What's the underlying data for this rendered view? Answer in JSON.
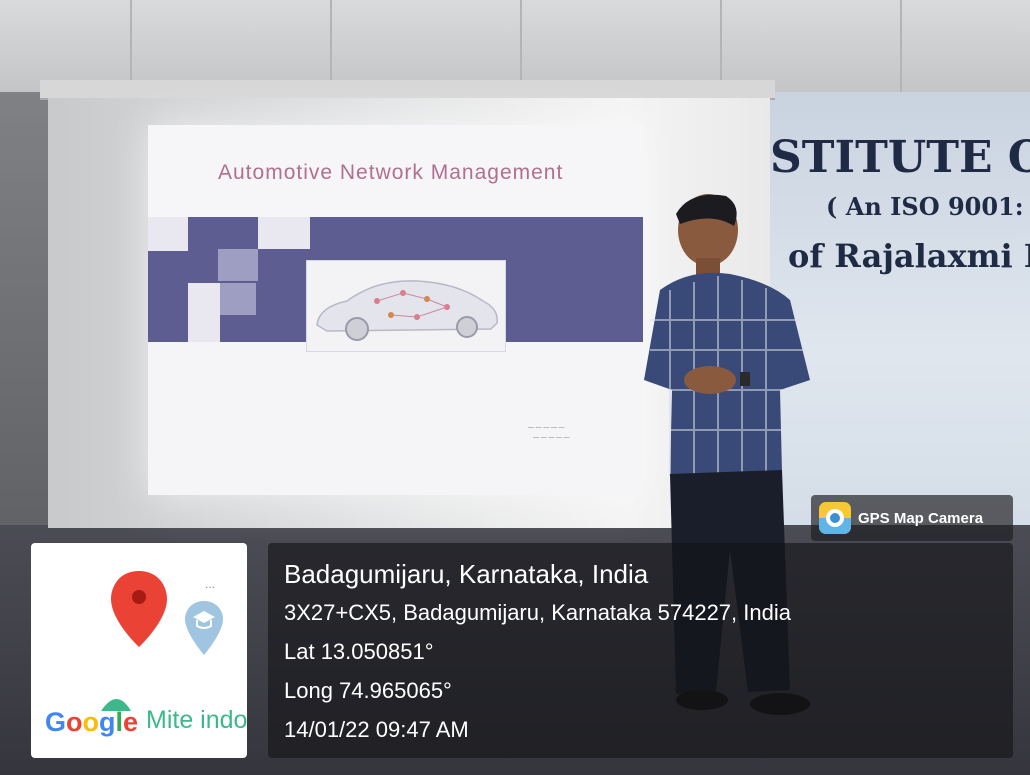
{
  "photo": {
    "slide": {
      "title": "Automotive Network Management"
    },
    "banner": {
      "line1": "STITUTE O",
      "line2": "( An ISO 9001:",
      "line3": "of Rajalaxmi E"
    }
  },
  "map": {
    "more_label": "...",
    "google_letters": [
      "G",
      "o",
      "o",
      "g",
      "l",
      "e"
    ],
    "google_colors": [
      "#4285f4",
      "#ea4335",
      "#fbbc05",
      "#4285f4",
      "#34a853",
      "#ea4335"
    ],
    "place_label": "Mite indo",
    "pin_color": "#ea4335",
    "poi_icon": "graduation-cap-icon"
  },
  "badge": {
    "label": "GPS Map Camera",
    "icon": "gps-map-camera-app-icon"
  },
  "location": {
    "place": "Badagumijaru, Karnataka, India",
    "address": "3X27+CX5, Badagumijaru, Karnataka 574227, India",
    "lat": "Lat 13.050851°",
    "long": "Long 74.965065°",
    "datetime": "14/01/22 09:47 AM"
  }
}
